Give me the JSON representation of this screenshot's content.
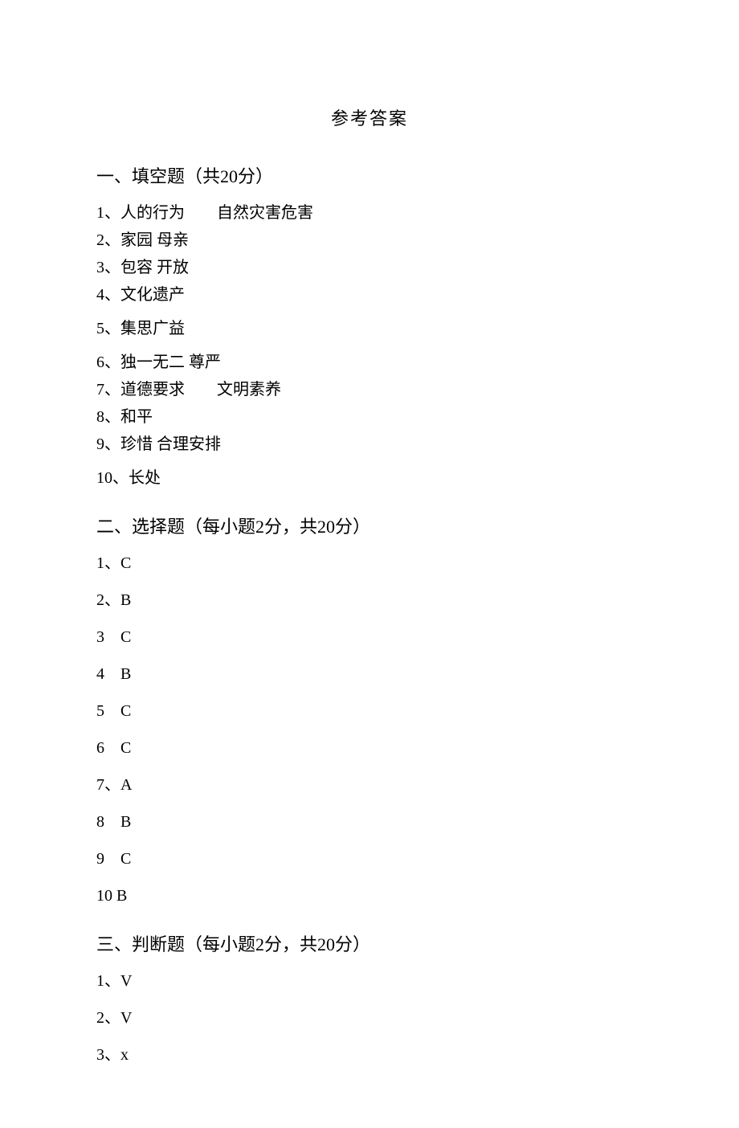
{
  "title": "参考答案",
  "sections": {
    "fill": {
      "heading": "一、填空题（共20分）",
      "items": [
        "1、人的行为  自然灾害危害",
        "2、家园 母亲",
        "3、包容 开放",
        "4、文化遗产",
        "5、集思广益",
        "6、独一无二 尊严",
        "7、道德要求  文明素养",
        "8、和平",
        "9、珍惜 合理安排",
        "10、长处"
      ]
    },
    "choice": {
      "heading": "二、选择题（每小题2分，共20分）",
      "items": [
        "1、C",
        "2、B",
        "3 C",
        "4 B",
        "5 C",
        "6 C",
        "7、A",
        "8 B",
        "9 C",
        "10 B"
      ]
    },
    "judge": {
      "heading": "三、判断题（每小题2分，共20分）",
      "items": [
        "1、V",
        "2、V",
        "3、x"
      ]
    }
  }
}
